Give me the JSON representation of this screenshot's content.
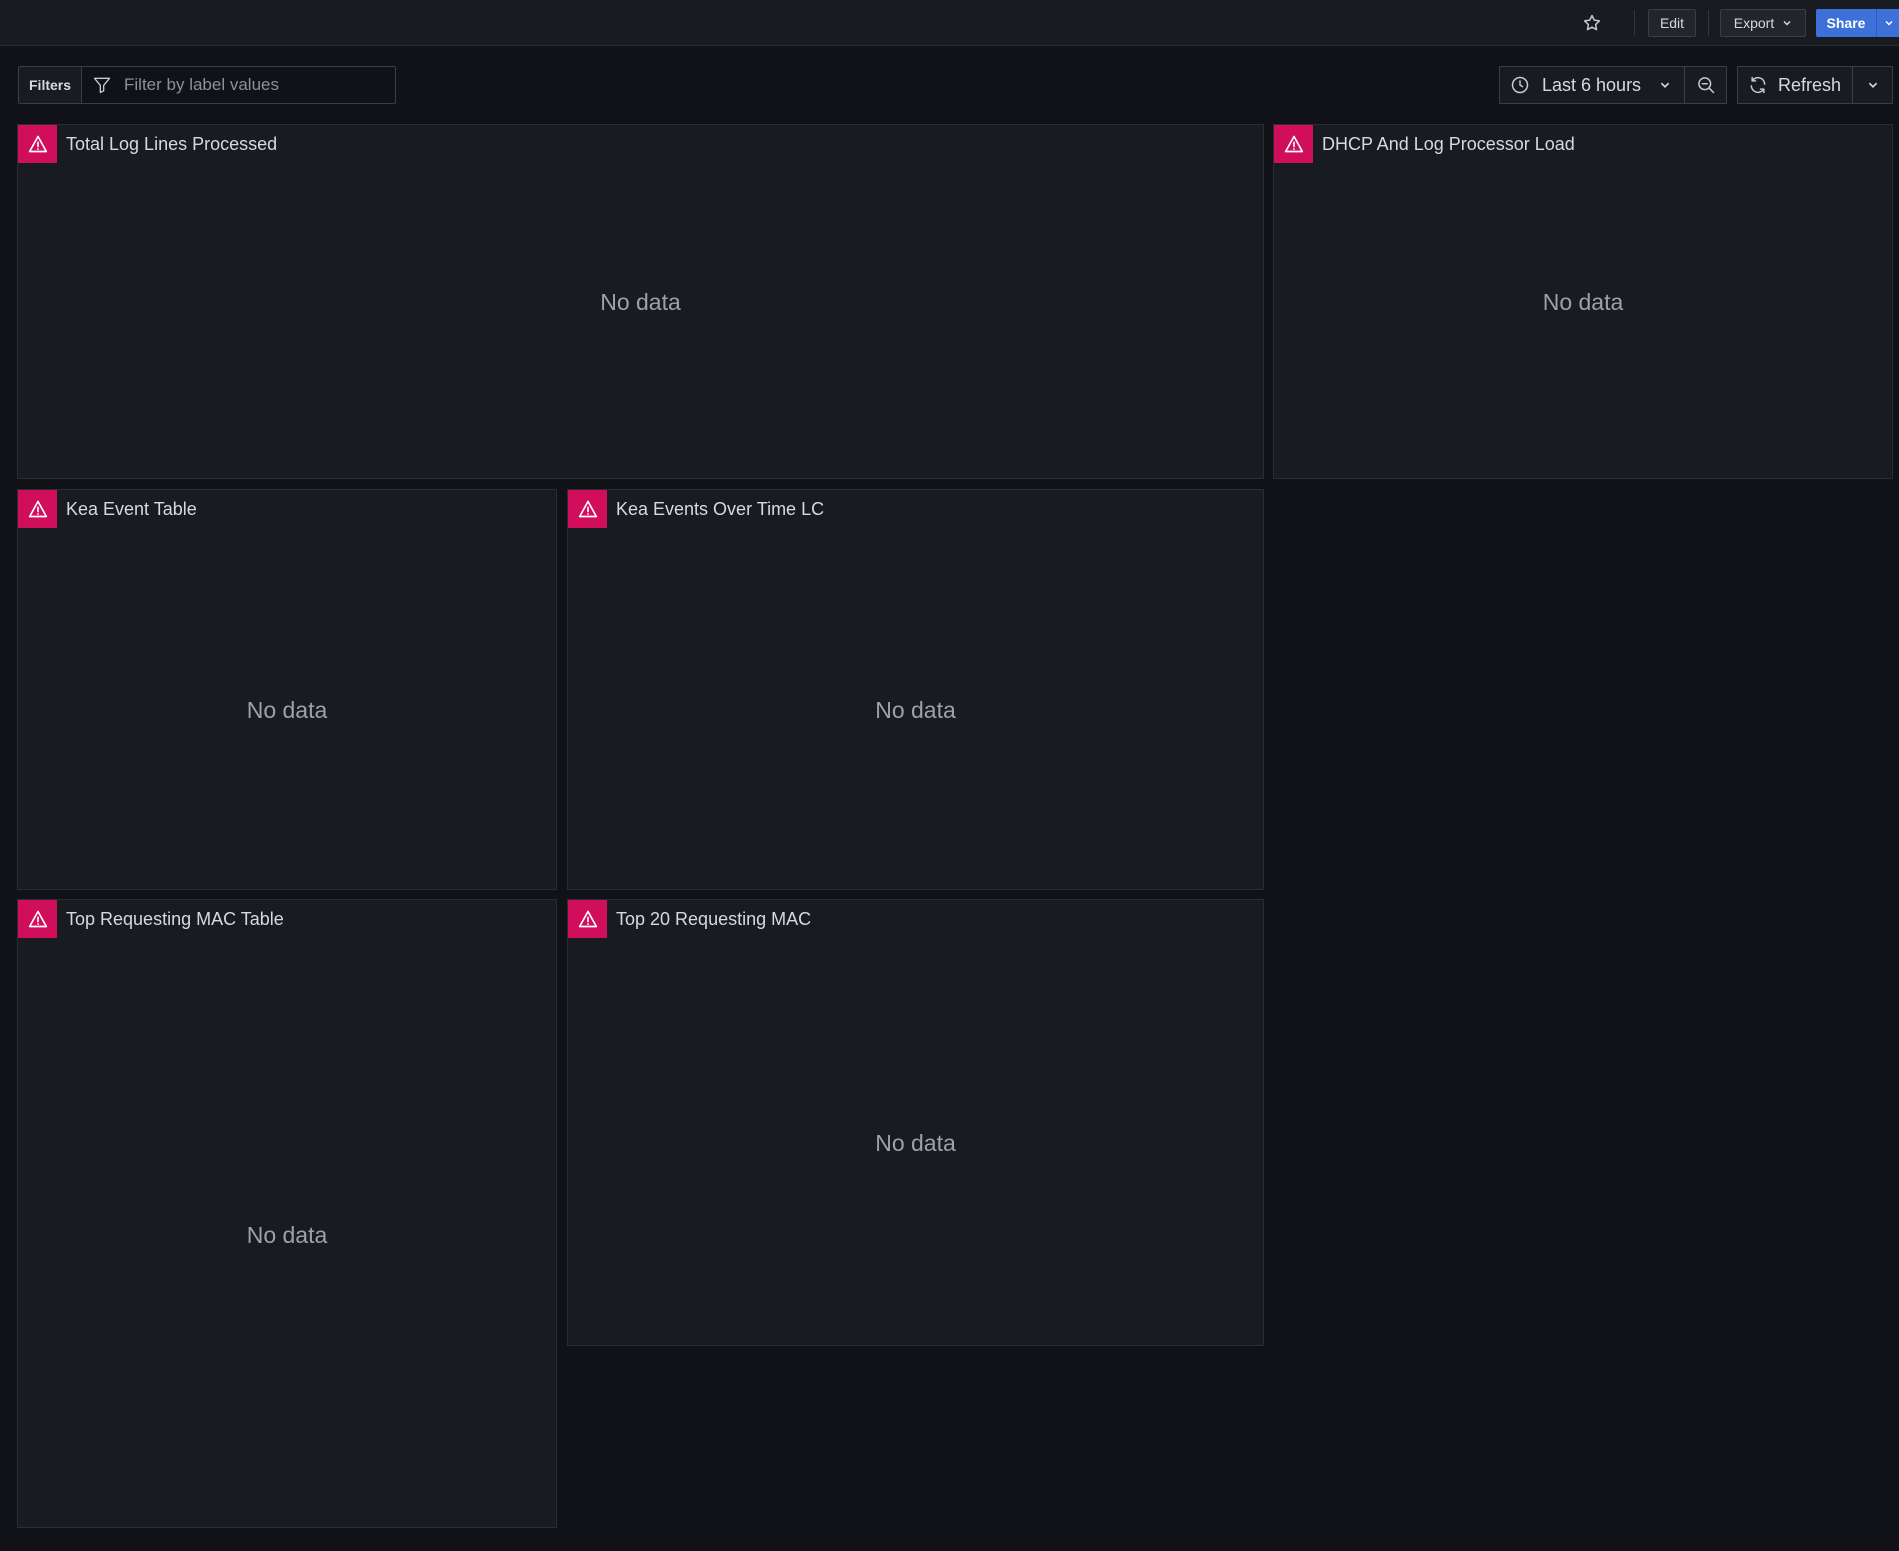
{
  "toolbar": {
    "star_icon": "star-icon",
    "edit_label": "Edit",
    "export_label": "Export",
    "share_label": "Share"
  },
  "filters": {
    "label": "Filters",
    "placeholder": "Filter by label values"
  },
  "time_picker": {
    "label": "Last 6 hours"
  },
  "refresh": {
    "label": "Refresh"
  },
  "colors": {
    "background": "#111217",
    "panel": "#181b1f",
    "alert": "#d10e5c",
    "share": "#3d71d9"
  },
  "panels": [
    {
      "title": "Total Log Lines Processed",
      "status": "No data"
    },
    {
      "title": "DHCP And Log Processor Load",
      "status": "No data"
    },
    {
      "title": "Kea Event Table",
      "status": "No data"
    },
    {
      "title": "Kea Events Over Time LC",
      "status": "No data"
    },
    {
      "title": "Top Requesting MAC Table",
      "status": "No data"
    },
    {
      "title": "Top 20 Requesting MAC",
      "status": "No data"
    }
  ]
}
